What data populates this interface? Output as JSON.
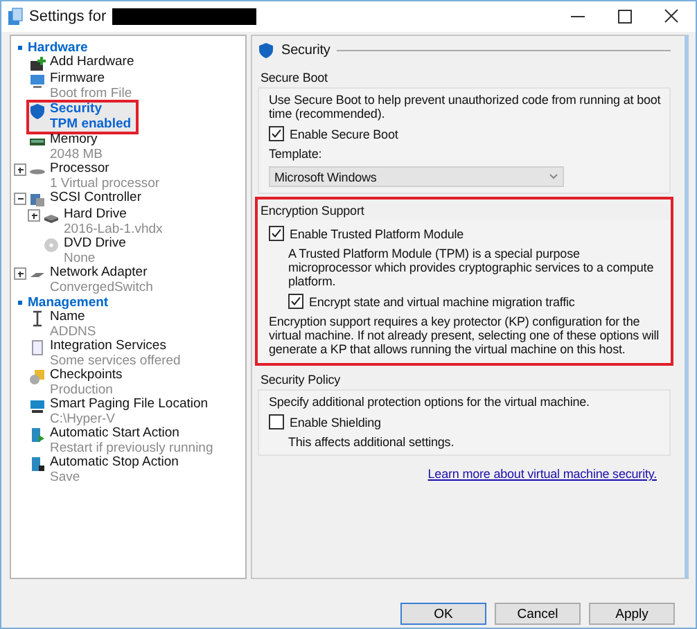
{
  "window": {
    "title": "Settings for"
  },
  "sidebar": {
    "sections": [
      {
        "label": "Hardware",
        "expanded": true,
        "items": [
          {
            "name": "Add Hardware",
            "selected": false,
            "outlined": false
          },
          {
            "name": "Firmware",
            "detail": "Boot from File",
            "selected": false,
            "outlined": false
          },
          {
            "name": "Security",
            "detail": "TPM enabled",
            "selected": true,
            "outlined": true
          },
          {
            "name": "Memory",
            "detail": "2048 MB",
            "selected": false,
            "outlined": false
          },
          {
            "name": "Processor",
            "detail": "1 Virtual processor",
            "selected": false,
            "outlined": false,
            "expanded": false
          },
          {
            "name": "SCSI Controller",
            "selected": false,
            "outlined": false,
            "expanded": true,
            "children": [
              {
                "name": "Hard Drive",
                "detail": "2016-Lab-1.vhdx",
                "selected": false,
                "outlined": false,
                "expanded": false
              },
              {
                "name": "DVD Drive",
                "detail": "None",
                "selected": false,
                "outlined": false
              }
            ]
          },
          {
            "name": "Network Adapter",
            "detail": "ConvergedSwitch",
            "selected": false,
            "outlined": false,
            "expanded": false
          }
        ]
      },
      {
        "label": "Management",
        "expanded": true,
        "items": [
          {
            "name": "Name",
            "detail": "ADDNS",
            "selected": false,
            "outlined": false
          },
          {
            "name": "Integration Services",
            "detail": "Some services offered",
            "selected": false,
            "outlined": false
          },
          {
            "name": "Checkpoints",
            "detail": "Production",
            "selected": false,
            "outlined": false
          },
          {
            "name": "Smart Paging File Location",
            "detail": "C:\\Hyper-V",
            "selected": false,
            "outlined": false
          },
          {
            "name": "Automatic Start Action",
            "detail": "Restart if previously running",
            "selected": false,
            "outlined": false
          },
          {
            "name": "Automatic Stop Action",
            "detail": "Save",
            "selected": false,
            "outlined": false
          }
        ]
      }
    ]
  },
  "panel": {
    "heading": "Security",
    "groups": [
      {
        "title": "Secure Boot",
        "outlined": false,
        "rows": [
          {
            "kind": "text",
            "text": "Use Secure Boot to help prevent unauthorized code from running at boot time (recommended)."
          },
          {
            "kind": "checkbox",
            "label": "Enable Secure Boot",
            "checked": true
          },
          {
            "kind": "label",
            "text": "Template:"
          },
          {
            "kind": "dropdown",
            "value": "Microsoft Windows"
          }
        ]
      },
      {
        "title": "Encryption Support",
        "outlined": true,
        "rows": [
          {
            "kind": "checkbox",
            "label": "Enable Trusted Platform Module",
            "checked": true
          },
          {
            "kind": "note",
            "text": "A Trusted Platform Module (TPM) is a special purpose microprocessor which provides cryptographic services to a compute platform."
          },
          {
            "kind": "subcheckbox",
            "label": "Encrypt state and virtual machine migration traffic",
            "checked": true
          },
          {
            "kind": "text",
            "text": "Encryption support requires a key protector (KP) configuration for the virtual machine. If not already present, selecting one of these options will generate a KP that allows running the virtual machine on this host."
          }
        ]
      },
      {
        "title": "Security Policy",
        "outlined": false,
        "rows": [
          {
            "kind": "text",
            "text": "Specify additional protection options for the virtual machine."
          },
          {
            "kind": "checkbox",
            "label": "Enable Shielding",
            "checked": false
          },
          {
            "kind": "note",
            "text": "This affects additional settings."
          }
        ]
      }
    ],
    "link": "Learn more about virtual machine security."
  },
  "buttons": [
    {
      "label": "OK",
      "default": true
    },
    {
      "label": "Cancel",
      "default": false
    },
    {
      "label": "Apply",
      "default": false
    }
  ]
}
